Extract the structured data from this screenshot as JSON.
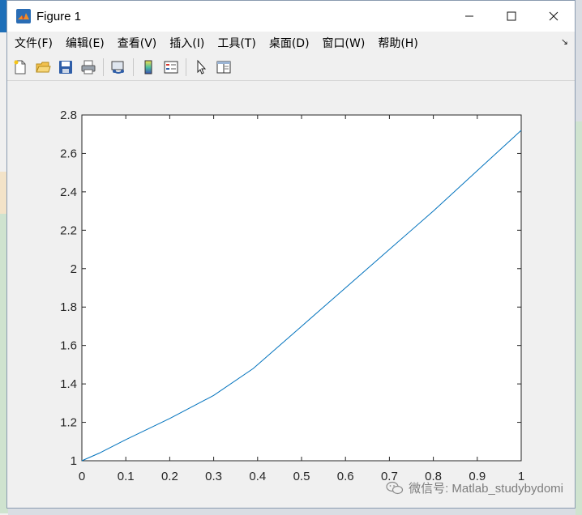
{
  "window": {
    "title": "Figure 1",
    "controls": [
      "minimize",
      "maximize",
      "close"
    ]
  },
  "menu": {
    "items": [
      "文件(F)",
      "编辑(E)",
      "查看(V)",
      "插入(I)",
      "工具(T)",
      "桌面(D)",
      "窗口(W)",
      "帮助(H)"
    ]
  },
  "toolbar": {
    "buttons": [
      "new-figure-icon",
      "open-file-icon",
      "save-icon",
      "print-icon",
      "link-plot-icon",
      "colorbar-icon",
      "legend-icon",
      "edit-plot-cursor-icon",
      "property-inspector-icon"
    ]
  },
  "chart_data": {
    "type": "line",
    "x": [
      0,
      0.04,
      0.1,
      0.2,
      0.3,
      0.39,
      0.5,
      0.6,
      0.7,
      0.8,
      0.9,
      1.0
    ],
    "series": [
      {
        "values": [
          1.0,
          1.04,
          1.11,
          1.22,
          1.34,
          1.48,
          1.7,
          1.9,
          2.1,
          2.3,
          2.51,
          2.72
        ],
        "color": "#0072bd"
      }
    ],
    "xlim": [
      0,
      1
    ],
    "ylim": [
      1,
      2.8
    ],
    "xticks": [
      "0",
      "0.1",
      "0.2",
      "0.3",
      "0.4",
      "0.5",
      "0.6",
      "0.7",
      "0.8",
      "0.9",
      "1"
    ],
    "yticks": [
      "1",
      "1.2",
      "1.4",
      "1.6",
      "1.8",
      "2",
      "2.2",
      "2.4",
      "2.6",
      "2.8"
    ],
    "grid": false
  },
  "watermark": {
    "text": "微信号: Matlab_studybydomi"
  }
}
